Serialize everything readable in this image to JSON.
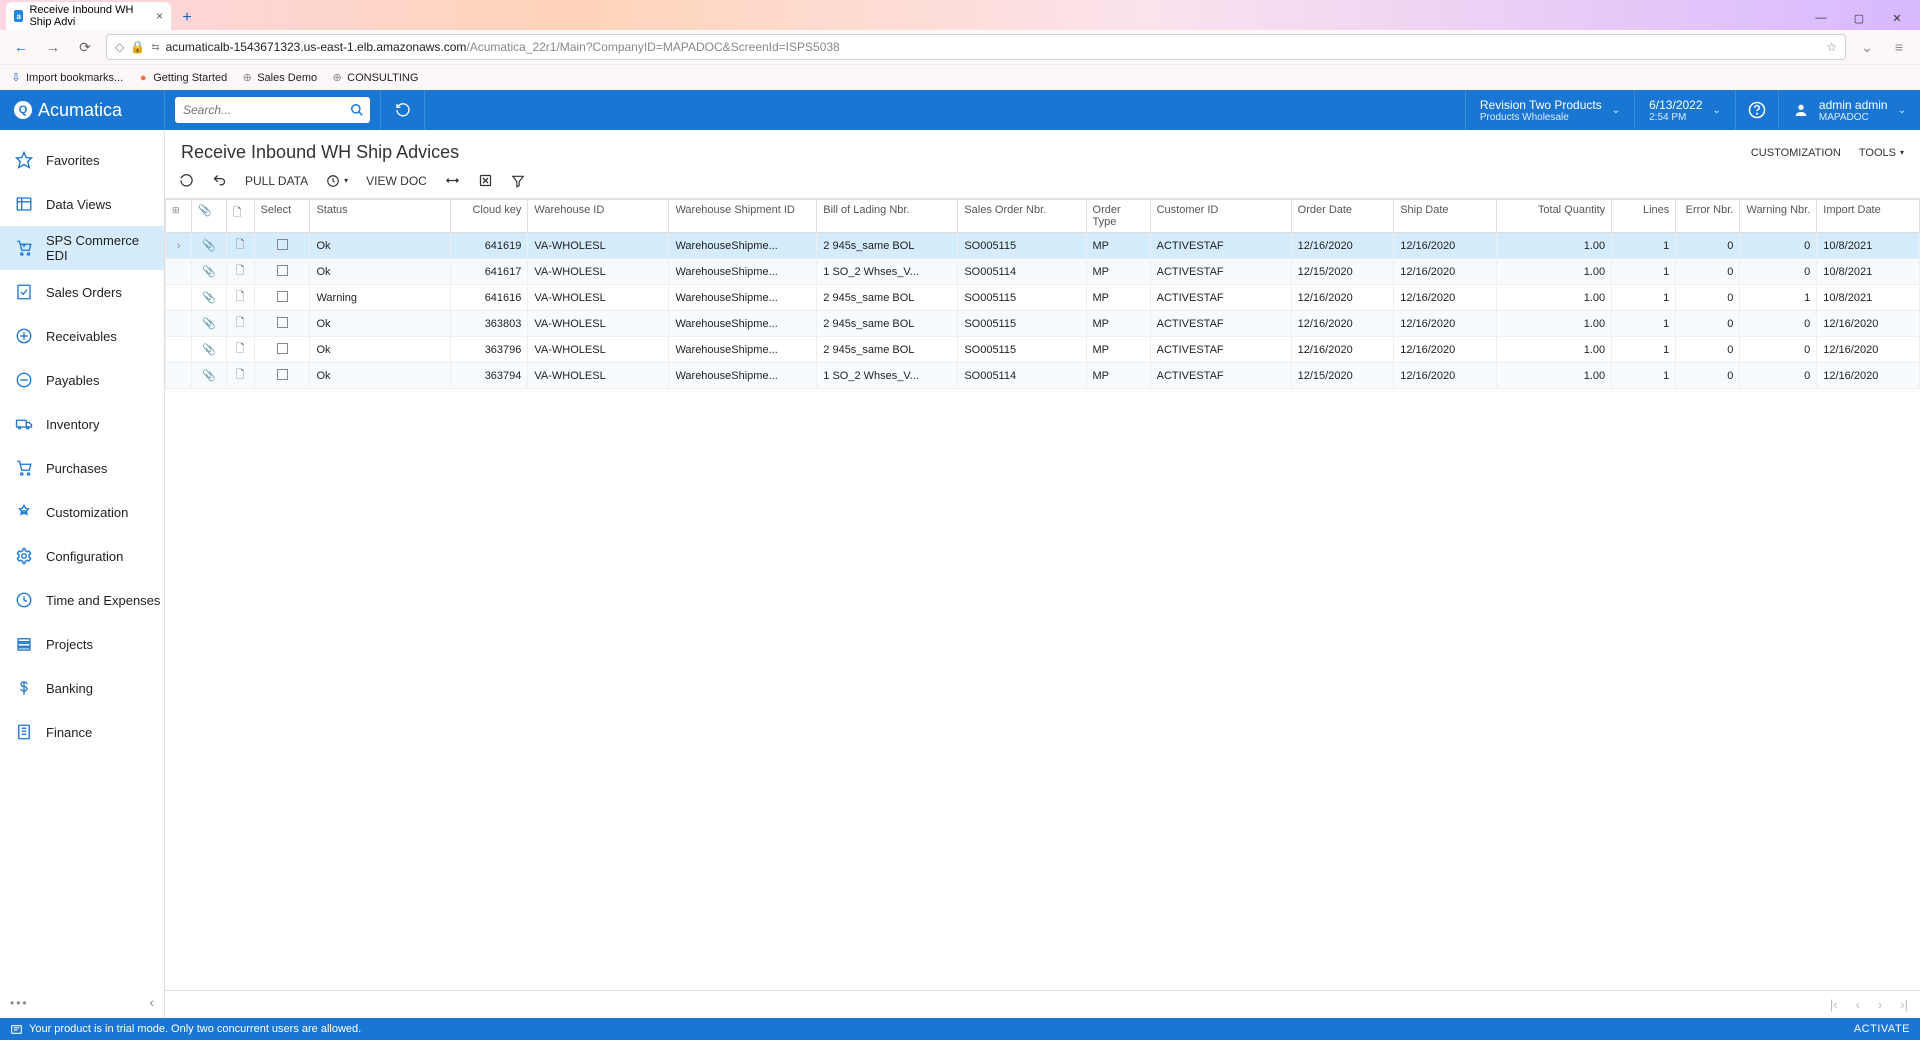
{
  "browser": {
    "tab_title": "Receive Inbound WH Ship Advi",
    "url_host": "acumaticalb-1543671323.us-east-1.elb.amazonaws.com",
    "url_path": "/Acumatica_22r1/Main?CompanyID=MAPADOC&ScreenId=ISPS5038",
    "bookmarks": [
      "Import bookmarks...",
      "Getting Started",
      "Sales Demo",
      "CONSULTING"
    ]
  },
  "topbar": {
    "brand": "Acumatica",
    "search_placeholder": "Search...",
    "business": {
      "line1": "Revision Two Products",
      "line2": "Products Wholesale"
    },
    "datetime": {
      "line1": "6/13/2022",
      "line2": "2:54 PM"
    },
    "user": {
      "line1": "admin admin",
      "line2": "MAPADOC"
    }
  },
  "sidebar": {
    "items": [
      {
        "label": "Favorites"
      },
      {
        "label": "Data Views"
      },
      {
        "label": "SPS Commerce EDI"
      },
      {
        "label": "Sales Orders"
      },
      {
        "label": "Receivables"
      },
      {
        "label": "Payables"
      },
      {
        "label": "Inventory"
      },
      {
        "label": "Purchases"
      },
      {
        "label": "Customization"
      },
      {
        "label": "Configuration"
      },
      {
        "label": "Time and Expenses"
      },
      {
        "label": "Projects"
      },
      {
        "label": "Banking"
      },
      {
        "label": "Finance"
      }
    ],
    "active_index": 2
  },
  "page": {
    "title": "Receive Inbound WH Ship Advices",
    "header_links": {
      "customization": "CUSTOMIZATION",
      "tools": "TOOLS"
    }
  },
  "toolbar": {
    "pull_data": "PULL DATA",
    "view_doc": "VIEW DOC"
  },
  "grid": {
    "columns": [
      "",
      "",
      "",
      "Select",
      "Status",
      "Cloud key",
      "Warehouse ID",
      "Warehouse Shipment ID",
      "Bill of Lading Nbr.",
      "Sales Order Nbr.",
      "Order Type",
      "Customer ID",
      "Order Date",
      "Ship Date",
      "Total Quantity",
      "Lines",
      "Error Nbr.",
      "Warning Nbr.",
      "Import Date"
    ],
    "rows": [
      {
        "status": "Ok",
        "cloud_key": "641619",
        "wh": "VA-WHOLESL",
        "wsid": "WarehouseShipme...",
        "bol": "2 945s_same BOL",
        "so": "SO005115",
        "ot": "MP",
        "cust": "ACTIVESTAF",
        "od": "12/16/2020",
        "sd": "12/16/2020",
        "qty": "1.00",
        "lines": "1",
        "err": "0",
        "warn": "0",
        "imp": "10/8/2021",
        "sel": true
      },
      {
        "status": "Ok",
        "cloud_key": "641617",
        "wh": "VA-WHOLESL",
        "wsid": "WarehouseShipme...",
        "bol": "1 SO_2 Whses_V...",
        "so": "SO005114",
        "ot": "MP",
        "cust": "ACTIVESTAF",
        "od": "12/15/2020",
        "sd": "12/16/2020",
        "qty": "1.00",
        "lines": "1",
        "err": "0",
        "warn": "0",
        "imp": "10/8/2021"
      },
      {
        "status": "Warning",
        "cloud_key": "641616",
        "wh": "VA-WHOLESL",
        "wsid": "WarehouseShipme...",
        "bol": "2 945s_same BOL",
        "so": "SO005115",
        "ot": "MP",
        "cust": "ACTIVESTAF",
        "od": "12/16/2020",
        "sd": "12/16/2020",
        "qty": "1.00",
        "lines": "1",
        "err": "0",
        "warn": "1",
        "imp": "10/8/2021"
      },
      {
        "status": "Ok",
        "cloud_key": "363803",
        "wh": "VA-WHOLESL",
        "wsid": "WarehouseShipme...",
        "bol": "2 945s_same BOL",
        "so": "SO005115",
        "ot": "MP",
        "cust": "ACTIVESTAF",
        "od": "12/16/2020",
        "sd": "12/16/2020",
        "qty": "1.00",
        "lines": "1",
        "err": "0",
        "warn": "0",
        "imp": "12/16/2020"
      },
      {
        "status": "Ok",
        "cloud_key": "363796",
        "wh": "VA-WHOLESL",
        "wsid": "WarehouseShipme...",
        "bol": "2 945s_same BOL",
        "so": "SO005115",
        "ot": "MP",
        "cust": "ACTIVESTAF",
        "od": "12/16/2020",
        "sd": "12/16/2020",
        "qty": "1.00",
        "lines": "1",
        "err": "0",
        "warn": "0",
        "imp": "12/16/2020"
      },
      {
        "status": "Ok",
        "cloud_key": "363794",
        "wh": "VA-WHOLESL",
        "wsid": "WarehouseShipme...",
        "bol": "1 SO_2 Whses_V...",
        "so": "SO005114",
        "ot": "MP",
        "cust": "ACTIVESTAF",
        "od": "12/15/2020",
        "sd": "12/16/2020",
        "qty": "1.00",
        "lines": "1",
        "err": "0",
        "warn": "0",
        "imp": "12/16/2020"
      }
    ]
  },
  "statusbar": {
    "message": "Your product is in trial mode. Only two concurrent users are allowed.",
    "activate": "ACTIVATE"
  }
}
